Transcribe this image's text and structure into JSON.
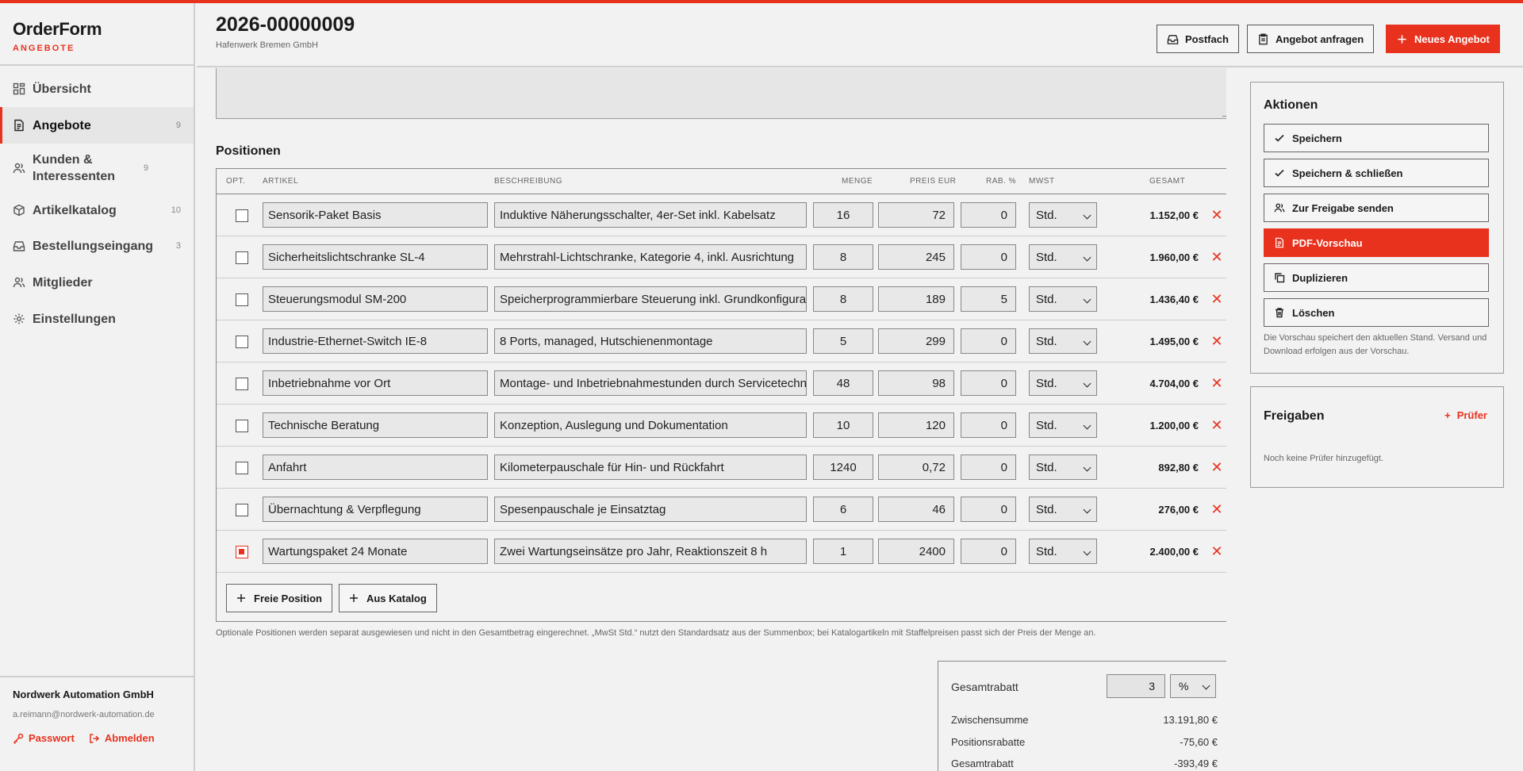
{
  "brand": {
    "name": "OrderForm",
    "section": "ANGEBOTE"
  },
  "nav": [
    {
      "label": "Übersicht",
      "count": "",
      "icon": "dashboard-icon"
    },
    {
      "label": "Angebote",
      "count": "9",
      "icon": "document-icon",
      "active": true
    },
    {
      "label": "Kunden & Interessenten",
      "count": "9",
      "icon": "users-icon"
    },
    {
      "label": "Artikelkatalog",
      "count": "10",
      "icon": "package-icon"
    },
    {
      "label": "Bestellungseingang",
      "count": "3",
      "icon": "inbox-icon"
    },
    {
      "label": "Mitglieder",
      "count": "",
      "icon": "members-icon"
    },
    {
      "label": "Einstellungen",
      "count": "",
      "icon": "gear-icon"
    }
  ],
  "account": {
    "org": "Nordwerk Automation GmbH",
    "email": "a.reimann@nordwerk-automation.de",
    "password_label": "Passwort",
    "logout_label": "Abmelden"
  },
  "header": {
    "title": "2026-00000009",
    "subtitle": "Hafenwerk Bremen GmbH",
    "inbox_label": "Postfach",
    "request_label": "Angebot anfragen",
    "new_label": "Neues Angebot"
  },
  "positions": {
    "title": "Positionen",
    "columns": {
      "opt": "OPT.",
      "article": "ARTIKEL",
      "description": "BESCHREIBUNG",
      "qty": "MENGE",
      "price": "PREIS EUR",
      "discount": "RAB. %",
      "vat": "MWST",
      "total": "GESAMT"
    },
    "rows": [
      {
        "optional": false,
        "article": "Sensorik-Paket Basis",
        "description": "Induktive Näherungsschalter, 4er-Set inkl. Kabelsatz",
        "qty": "16",
        "price": "72",
        "discount": "0",
        "vat": "Std.",
        "total": "1.152,00 €"
      },
      {
        "optional": false,
        "article": "Sicherheitslichtschranke SL-4",
        "description": "Mehrstrahl-Lichtschranke, Kategorie 4, inkl. Ausrichtung",
        "qty": "8",
        "price": "245",
        "discount": "0",
        "vat": "Std.",
        "total": "1.960,00 €"
      },
      {
        "optional": false,
        "article": "Steuerungsmodul SM-200",
        "description": "Speicherprogrammierbare Steuerung inkl. Grundkonfiguration",
        "qty": "8",
        "price": "189",
        "discount": "5",
        "vat": "Std.",
        "total": "1.436,40 €"
      },
      {
        "optional": false,
        "article": "Industrie-Ethernet-Switch IE-8",
        "description": "8 Ports, managed, Hutschienenmontage",
        "qty": "5",
        "price": "299",
        "discount": "0",
        "vat": "Std.",
        "total": "1.495,00 €"
      },
      {
        "optional": false,
        "article": "Inbetriebnahme vor Ort",
        "description": "Montage- und Inbetriebnahmestunden durch Servicetechniker",
        "qty": "48",
        "price": "98",
        "discount": "0",
        "vat": "Std.",
        "total": "4.704,00 €"
      },
      {
        "optional": false,
        "article": "Technische Beratung",
        "description": "Konzeption, Auslegung und Dokumentation",
        "qty": "10",
        "price": "120",
        "discount": "0",
        "vat": "Std.",
        "total": "1.200,00 €"
      },
      {
        "optional": false,
        "article": "Anfahrt",
        "description": "Kilometerpauschale für Hin- und Rückfahrt",
        "qty": "1240",
        "price": "0,72",
        "discount": "0",
        "vat": "Std.",
        "total": "892,80 €"
      },
      {
        "optional": false,
        "article": "Übernachtung & Verpflegung",
        "description": "Spesenpauschale je Einsatztag",
        "qty": "6",
        "price": "46",
        "discount": "0",
        "vat": "Std.",
        "total": "276,00 €"
      },
      {
        "optional": true,
        "article": "Wartungspaket 24 Monate",
        "description": "Zwei Wartungseinsätze pro Jahr, Reaktionszeit 8 h",
        "qty": "1",
        "price": "2400",
        "discount": "0",
        "vat": "Std.",
        "total": "2.400,00 €"
      }
    ],
    "add_free_label": "Freie Position",
    "add_catalog_label": "Aus Katalog",
    "note": "Optionale Positionen werden separat ausgewiesen und nicht in den Gesamtbetrag eingerechnet. „MwSt Std.“ nutzt den Standardsatz aus der Summenbox; bei Katalogartikeln mit Staffelpreisen passt sich der Preis der Menge an."
  },
  "summary": {
    "discount_label": "Gesamtrabatt",
    "discount_value": "3",
    "discount_unit": "%",
    "subtotal_label": "Zwischensumme",
    "subtotal_value": "13.191,80 €",
    "item_discount_label": "Positionsrabatte",
    "item_discount_value": "-75,60 €",
    "total_discount_label": "Gesamtrabatt",
    "total_discount_value": "-393,49 €"
  },
  "actions": {
    "title": "Aktionen",
    "save": "Speichern",
    "save_close": "Speichern & schließen",
    "approval": "Zur Freigabe senden",
    "pdf": "PDF-Vorschau",
    "duplicate": "Duplizieren",
    "delete": "Löschen",
    "hint": "Die Vorschau speichert den aktuellen Stand. Versand und Download erfolgen aus der Vorschau."
  },
  "approvals": {
    "title": "Freigaben",
    "add_label": "Prüfer",
    "empty": "Noch keine Prüfer hinzugefügt."
  },
  "colors": {
    "accent": "#e8321e",
    "background": "#f2f2f2",
    "border": "#888888"
  }
}
